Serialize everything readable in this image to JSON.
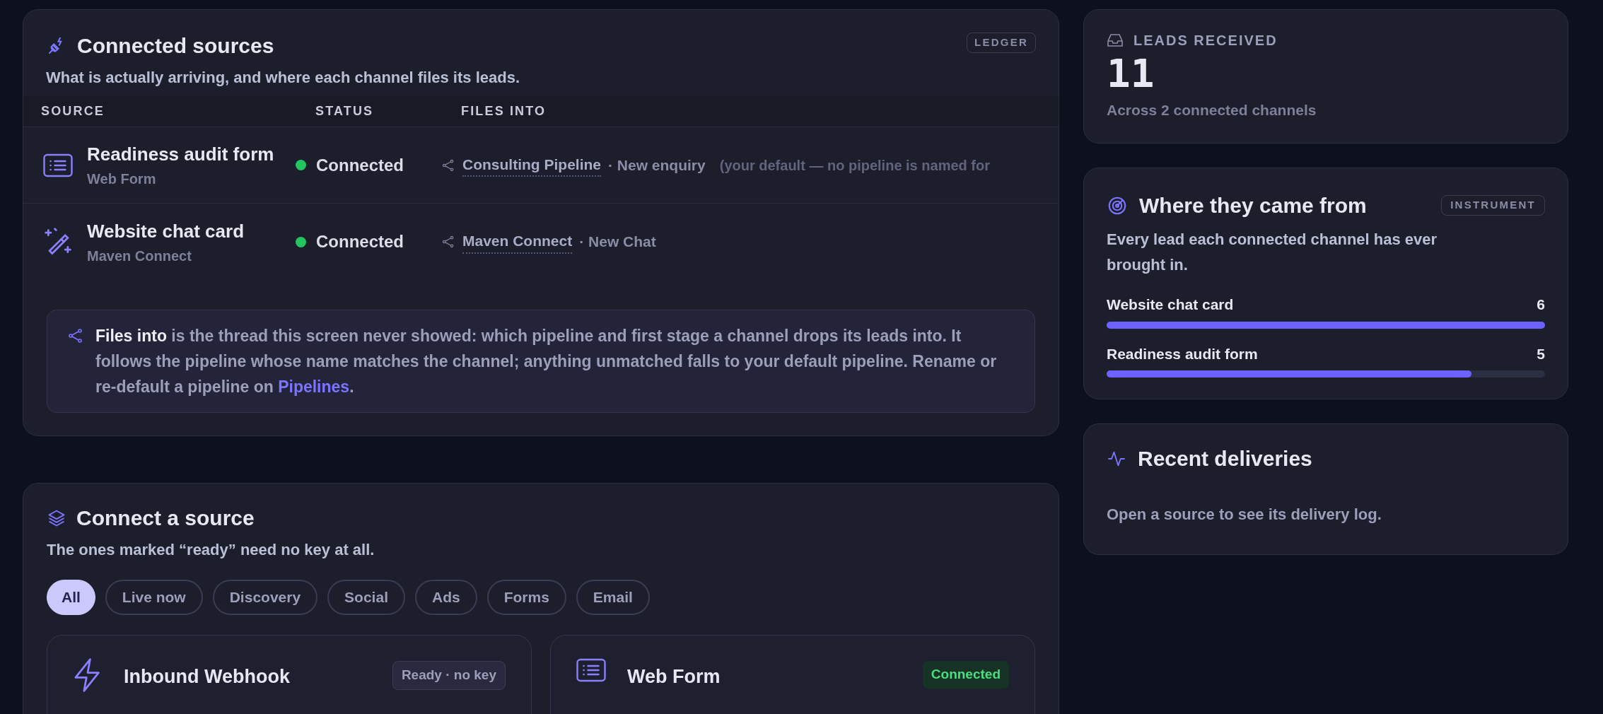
{
  "connected_sources": {
    "title": "Connected sources",
    "subtitle": "What is actually arriving, and where each channel files its leads.",
    "badge": "LEDGER",
    "columns": [
      "SOURCE",
      "STATUS",
      "FILES INTO"
    ],
    "rows": [
      {
        "kind": "form",
        "name": "Readiness audit form",
        "type": "Web Form",
        "status": "Connected",
        "pipeline": "Consulting Pipeline",
        "stage": "· New enquiry",
        "note": "(your default — no pipeline is named for"
      },
      {
        "kind": "chat",
        "name": "Website chat card",
        "type": "Maven Connect",
        "status": "Connected",
        "pipeline": "Maven Connect",
        "stage": "· New Chat"
      }
    ],
    "info": "**Files into** is the thread this screen never showed: which pipeline and first stage a channel drops its leads into. It follows the pipeline whose name matches the channel; anything unmatched falls to your default pipeline. Rename or re-default a pipeline on ",
    "info_link": "Pipelines",
    "info_end": "."
  },
  "connect_source": {
    "title": "Connect a source",
    "subtitle": "The ones marked “ready” need no key at all.",
    "filters": [
      {
        "label": "All",
        "selected": true
      },
      {
        "label": "Live now",
        "selected": false
      },
      {
        "label": "Discovery",
        "selected": false
      },
      {
        "label": "Social",
        "selected": false
      },
      {
        "label": "Ads",
        "selected": false
      },
      {
        "label": "Forms",
        "selected": false
      },
      {
        "label": "Email",
        "selected": false
      }
    ],
    "sources": [
      {
        "kind": "webhook",
        "name": "Inbound Webhook",
        "badge": "Ready · no key",
        "connected": false
      },
      {
        "kind": "form",
        "name": "Web Form",
        "badge": "Connected",
        "connected": true
      }
    ]
  },
  "leads_received": {
    "label": "LEADS RECEIVED",
    "count": "11",
    "caption": "Across 2 connected channels"
  },
  "where_from": {
    "title": "Where they came from",
    "badge": "INSTRUMENT",
    "subtitle": "Every lead each connected channel has ever brought in.",
    "items": [
      {
        "name": "Website chat card",
        "count": "6",
        "level": 1
      },
      {
        "name": "Readiness audit form",
        "count": "5",
        "level": 0.833
      }
    ]
  },
  "recent_deliveries": {
    "title": "Recent deliveries",
    "empty": "Open a source to see its delivery log."
  }
}
